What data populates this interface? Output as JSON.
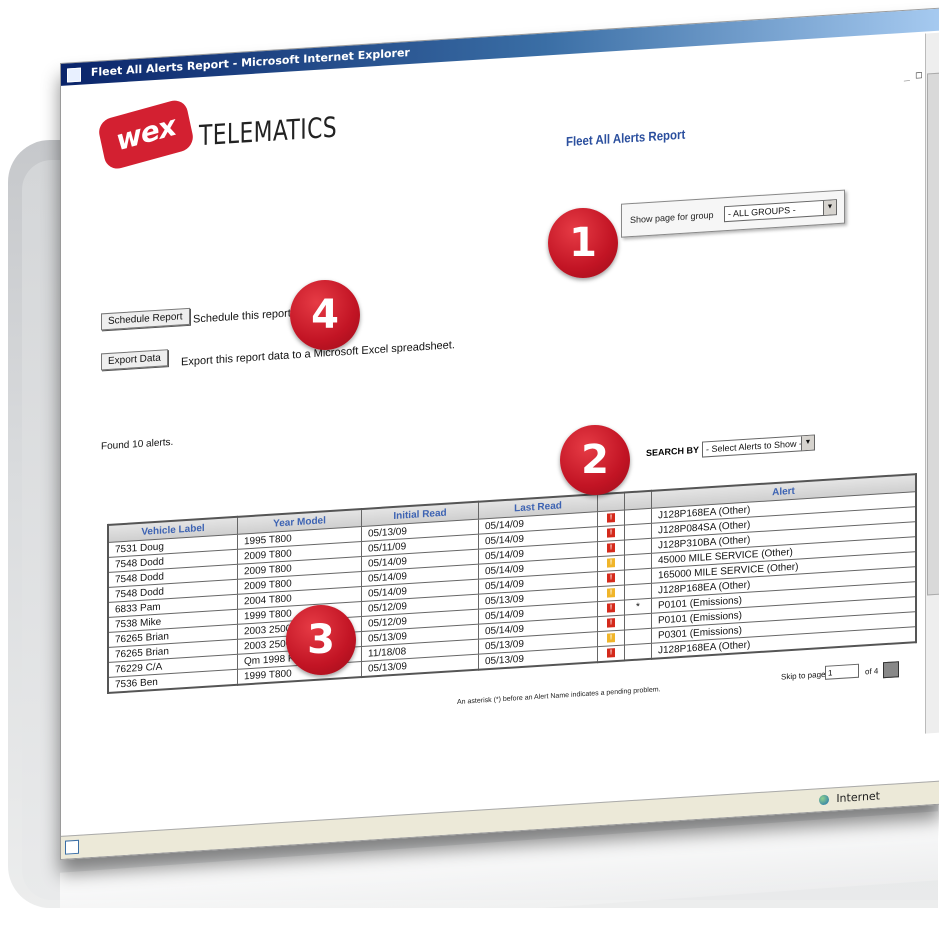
{
  "window": {
    "title": "Fleet All Alerts Report - Microsoft Internet Explorer",
    "controls": "_ □ ×",
    "status_zone": "Internet"
  },
  "brand": {
    "logo_text": "wex",
    "brand_text": "TELEMATICS",
    "accent": "#d32031"
  },
  "report": {
    "title": "Fleet All Alerts Report"
  },
  "group": {
    "label": "Show page for group",
    "selected": "- ALL GROUPS -"
  },
  "actions": {
    "schedule_label": "Schedule Report",
    "schedule_desc": "Schedule this report.",
    "export_label": "Export Data",
    "export_desc": "Export this report data to a Microsoft Excel spreadsheet."
  },
  "found_text": "Found 10 alerts.",
  "search": {
    "label": "SEARCH BY",
    "selected": "- Select Alerts to Show -"
  },
  "table": {
    "headers": [
      "Vehicle Label",
      "Year Model",
      "Initial Read",
      "Last Read",
      "",
      "",
      "Alert"
    ],
    "rows": [
      {
        "vehicle": "7531 Doug",
        "year": "1995 T800",
        "initial": "05/13/09",
        "last": "05/14/09",
        "sev": "red",
        "sev_icon": "!",
        "pending": "",
        "alert": "J128P168EA (Other)"
      },
      {
        "vehicle": "7548 Dodd",
        "year": "2009 T800",
        "initial": "05/11/09",
        "last": "05/14/09",
        "sev": "red",
        "sev_icon": "!",
        "pending": "",
        "alert": "J128P084SA (Other)"
      },
      {
        "vehicle": "7548 Dodd",
        "year": "2009 T800",
        "initial": "05/14/09",
        "last": "05/14/09",
        "sev": "red",
        "sev_icon": "!",
        "pending": "",
        "alert": "J128P310BA (Other)"
      },
      {
        "vehicle": "7548 Dodd",
        "year": "2009 T800",
        "initial": "05/14/09",
        "last": "05/14/09",
        "sev": "yellow",
        "sev_icon": "!",
        "pending": "",
        "alert": "45000 MILE SERVICE (Other)"
      },
      {
        "vehicle": "6833 Pam",
        "year": "2004 T800",
        "initial": "05/14/09",
        "last": "05/14/09",
        "sev": "red",
        "sev_icon": "!",
        "pending": "",
        "alert": "165000 MILE SERVICE (Other)"
      },
      {
        "vehicle": "7538 Mike",
        "year": "1999 T800",
        "initial": "05/12/09",
        "last": "05/13/09",
        "sev": "yellow",
        "sev_icon": "!",
        "pending": "",
        "alert": "J128P168EA (Other)"
      },
      {
        "vehicle": "76265 Brian",
        "year": "2003 2500",
        "initial": "05/12/09",
        "last": "05/14/09",
        "sev": "red",
        "sev_icon": "!",
        "pending": "*",
        "alert": "P0101 (Emissions)"
      },
      {
        "vehicle": "76265 Brian",
        "year": "2003 2500HD",
        "initial": "05/13/09",
        "last": "05/14/09",
        "sev": "red",
        "sev_icon": "!",
        "pending": "",
        "alert": "P0101 (Emissions)"
      },
      {
        "vehicle": "76229 C/A",
        "year": "Qm 1998 K1500",
        "initial": "11/18/08",
        "last": "05/13/09",
        "sev": "yellow",
        "sev_icon": "!",
        "pending": "",
        "alert": "P0301 (Emissions)"
      },
      {
        "vehicle": "7536 Ben",
        "year": "1999 T800",
        "initial": "05/13/09",
        "last": "05/13/09",
        "sev": "red",
        "sev_icon": "!",
        "pending": "",
        "alert": "J128P168EA (Other)"
      }
    ],
    "footnote": "An asterisk (*) before an Alert Name indicates a pending problem."
  },
  "pager": {
    "label": "Skip to page",
    "value": "1",
    "of": "of 4"
  },
  "markers": [
    "1",
    "2",
    "3",
    "4"
  ],
  "colors": {
    "title_blue": "#2b4f9e",
    "header_blue": "#3d63b3",
    "severity_red": "#d42a1c",
    "severity_yellow": "#f0b52a"
  }
}
